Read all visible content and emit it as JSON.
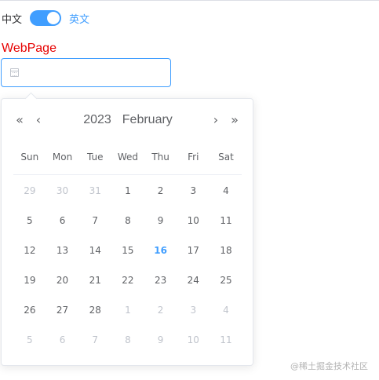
{
  "colors": {
    "accent": "#409eff",
    "page_label": "#e60000",
    "text": "#606266",
    "muted": "#c0c4cc"
  },
  "language_switch": {
    "left_label": "中文",
    "right_label": "英文",
    "state": "on"
  },
  "page_label": "WebPage",
  "date_input": {
    "value": "",
    "placeholder": "",
    "icon": "calendar-icon"
  },
  "picker": {
    "prev_year_icon": "«",
    "prev_month_icon": "‹",
    "next_month_icon": "›",
    "next_year_icon": "»",
    "year": "2023",
    "month": "February",
    "weekdays": [
      "Sun",
      "Mon",
      "Tue",
      "Wed",
      "Thu",
      "Fri",
      "Sat"
    ],
    "weeks": [
      [
        "29",
        "30",
        "31",
        "1",
        "2",
        "3",
        "4"
      ],
      [
        "5",
        "6",
        "7",
        "8",
        "9",
        "10",
        "11"
      ],
      [
        "12",
        "13",
        "14",
        "15",
        "16",
        "17",
        "18"
      ],
      [
        "19",
        "20",
        "21",
        "22",
        "23",
        "24",
        "25"
      ],
      [
        "26",
        "27",
        "28",
        "1",
        "2",
        "3",
        "4"
      ],
      [
        "5",
        "6",
        "7",
        "8",
        "9",
        "10",
        "11"
      ]
    ],
    "today": "16"
  },
  "watermark": "@稀土掘金技术社区"
}
